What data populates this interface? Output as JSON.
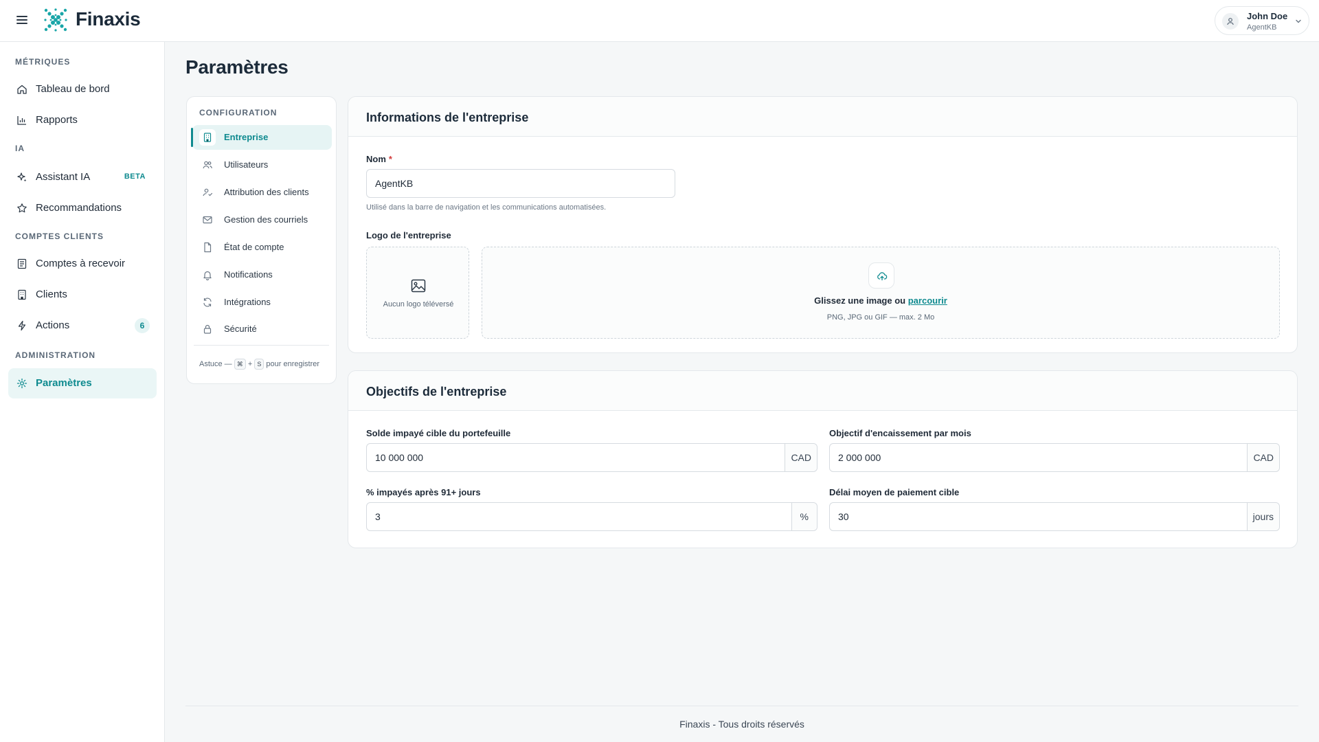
{
  "header": {
    "brand": "Finaxis",
    "user": {
      "name": "John Doe",
      "org": "AgentKB"
    }
  },
  "sidebar": {
    "sections": [
      {
        "title": "MÉTRIQUES"
      },
      {
        "title": "IA"
      },
      {
        "title": "COMPTES CLIENTS"
      },
      {
        "title": "ADMINISTRATION"
      }
    ],
    "items": [
      {
        "label": "Tableau de bord"
      },
      {
        "label": "Rapports"
      },
      {
        "label": "Assistant IA",
        "badge": "BETA"
      },
      {
        "label": "Recommandations"
      },
      {
        "label": "Comptes à recevoir"
      },
      {
        "label": "Clients"
      },
      {
        "label": "Actions",
        "badge": "6"
      },
      {
        "label": "Paramètres"
      }
    ]
  },
  "page": {
    "title": "Paramètres"
  },
  "settings_nav": {
    "title": "CONFIGURATION",
    "items": [
      {
        "label": "Entreprise"
      },
      {
        "label": "Utilisateurs"
      },
      {
        "label": "Attribution des clients"
      },
      {
        "label": "Gestion des courriels"
      },
      {
        "label": "État de compte"
      },
      {
        "label": "Notifications"
      },
      {
        "label": "Intégrations"
      },
      {
        "label": "Sécurité"
      }
    ],
    "tip": {
      "prefix": "Astuce —",
      "key1": "⌘",
      "plus": "+",
      "key2": "S",
      "suffix": "pour enregistrer"
    }
  },
  "company_info": {
    "title": "Informations de l'entreprise",
    "name_label": "Nom",
    "required_mark": "*",
    "name_value": "AgentKB",
    "name_help": "Utilisé dans la barre de navigation et les communications automatisées.",
    "logo_label": "Logo de l'entreprise",
    "no_logo": "Aucun logo téléversé",
    "drop_text": "Glissez une image ou",
    "drop_link": "parcourir",
    "drop_hint": "PNG, JPG ou GIF — max. 2 Mo"
  },
  "objectives": {
    "title": "Objectifs de l'entreprise",
    "fields": [
      {
        "label": "Solde impayé cible du portefeuille",
        "value": "10 000 000",
        "unit": "CAD"
      },
      {
        "label": "Objectif d'encaissement par mois",
        "value": "2 000 000",
        "unit": "CAD"
      },
      {
        "label": "% impayés après 91+ jours",
        "value": "3",
        "unit": "%"
      },
      {
        "label": "Délai moyen de paiement cible",
        "value": "30",
        "unit": "jours"
      }
    ]
  },
  "footer": {
    "text": "Finaxis - Tous droits réservés"
  },
  "colors": {
    "accent": "#0e8a8f",
    "required": "#d23b3b",
    "background": "#f5f7f8"
  }
}
